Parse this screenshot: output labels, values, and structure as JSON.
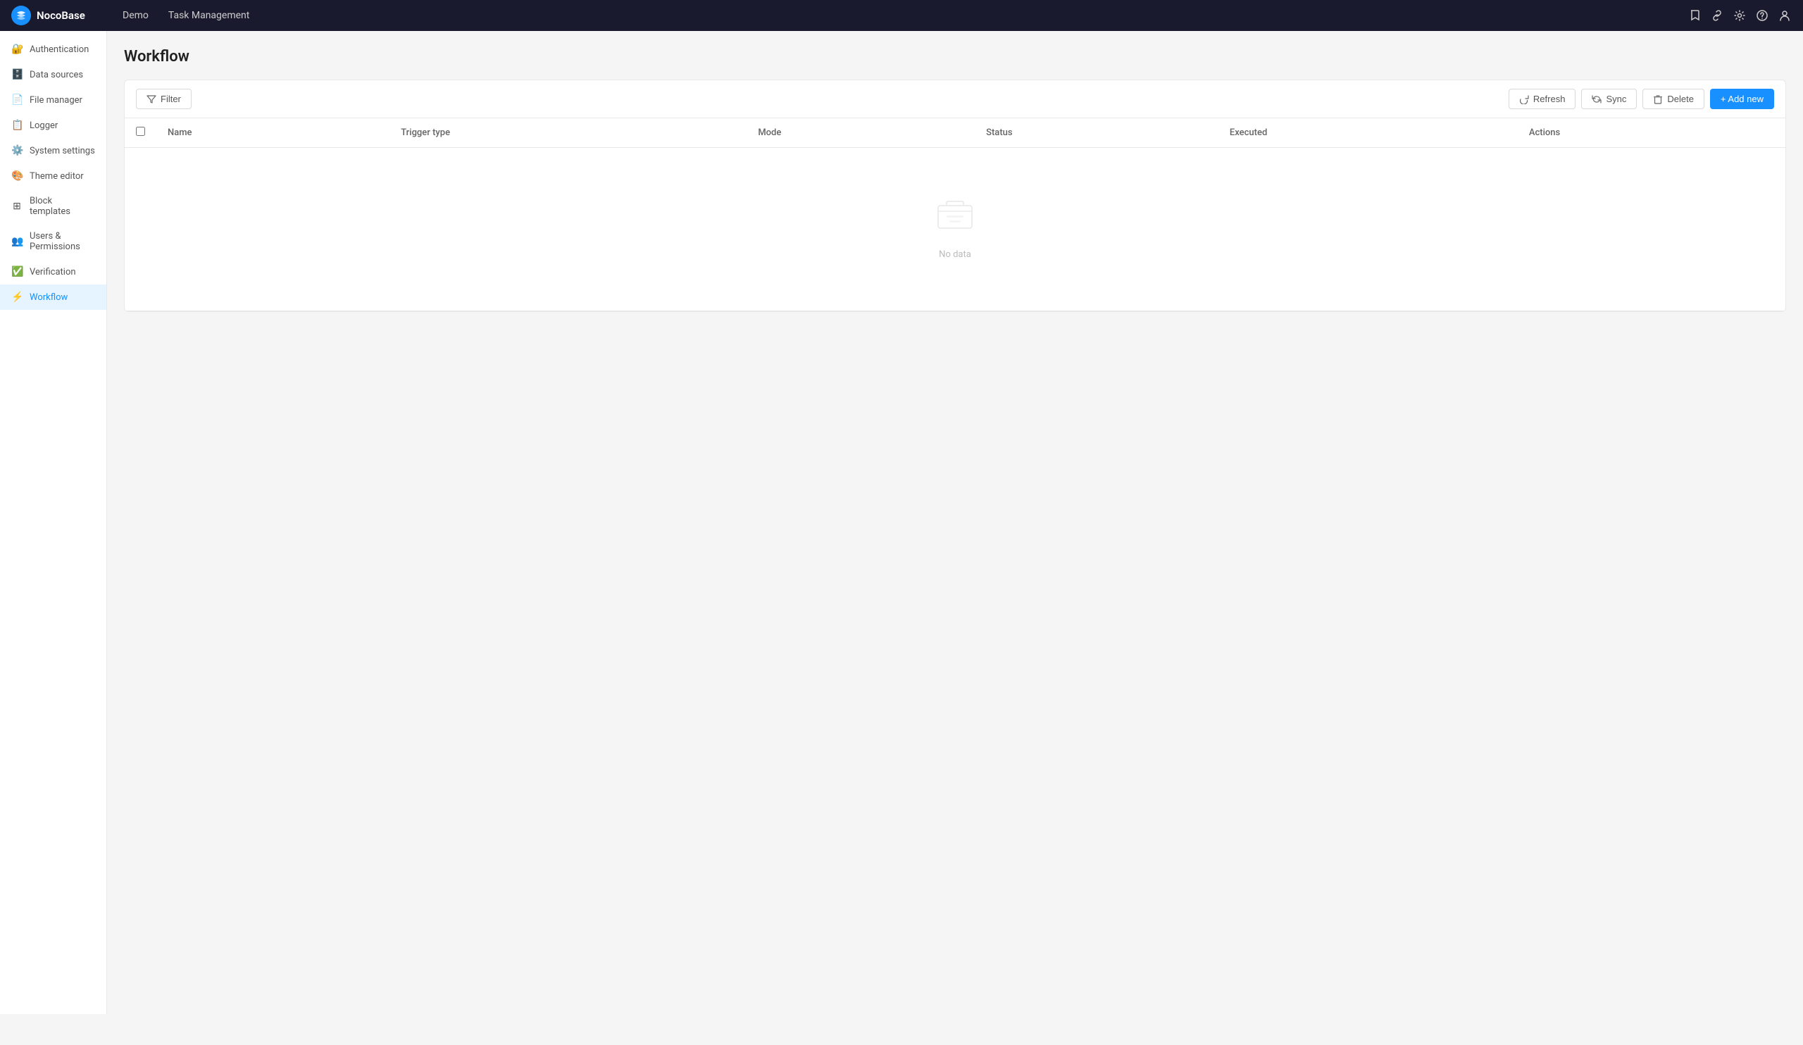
{
  "app": {
    "name": "NocoBase"
  },
  "topnav": {
    "tabs": [
      {
        "label": "Demo",
        "active": false
      },
      {
        "label": "Task Management",
        "active": false
      }
    ],
    "icons": [
      "bookmark",
      "link",
      "settings",
      "help",
      "user"
    ]
  },
  "sidebar": {
    "items": [
      {
        "id": "authentication",
        "label": "Authentication",
        "icon": "🔐",
        "active": false
      },
      {
        "id": "data-sources",
        "label": "Data sources",
        "icon": "🗄️",
        "active": false
      },
      {
        "id": "file-manager",
        "label": "File manager",
        "icon": "📄",
        "active": false
      },
      {
        "id": "logger",
        "label": "Logger",
        "icon": "📋",
        "active": false
      },
      {
        "id": "system-settings",
        "label": "System settings",
        "icon": "⚙️",
        "active": false
      },
      {
        "id": "theme-editor",
        "label": "Theme editor",
        "icon": "🎨",
        "active": false
      },
      {
        "id": "block-templates",
        "label": "Block templates",
        "icon": "⊞",
        "active": false
      },
      {
        "id": "users-permissions",
        "label": "Users & Permissions",
        "icon": "👥",
        "active": false
      },
      {
        "id": "verification",
        "label": "Verification",
        "icon": "✅",
        "active": false
      },
      {
        "id": "workflow",
        "label": "Workflow",
        "icon": "⚡",
        "active": true
      }
    ]
  },
  "main": {
    "page_title": "Workflow",
    "toolbar": {
      "filter_label": "Filter",
      "refresh_label": "Refresh",
      "sync_label": "Sync",
      "delete_label": "Delete",
      "add_new_label": "+ Add new"
    },
    "table": {
      "columns": [
        {
          "id": "name",
          "label": "Name"
        },
        {
          "id": "trigger-type",
          "label": "Trigger type"
        },
        {
          "id": "mode",
          "label": "Mode"
        },
        {
          "id": "status",
          "label": "Status"
        },
        {
          "id": "executed",
          "label": "Executed"
        },
        {
          "id": "actions",
          "label": "Actions"
        }
      ],
      "rows": [],
      "empty_text": "No data"
    }
  }
}
